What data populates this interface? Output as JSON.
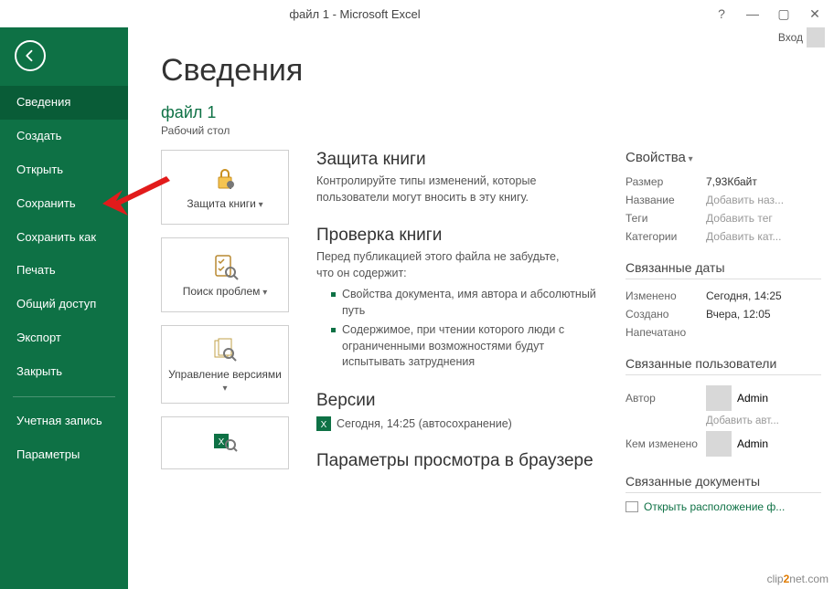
{
  "window": {
    "title": "файл 1 - Microsoft Excel",
    "help": "?",
    "user_label": "Вход"
  },
  "sidebar": {
    "items": [
      {
        "label": "Сведения",
        "active": true
      },
      {
        "label": "Создать"
      },
      {
        "label": "Открыть"
      },
      {
        "label": "Сохранить"
      },
      {
        "label": "Сохранить как"
      },
      {
        "label": "Печать"
      },
      {
        "label": "Общий доступ"
      },
      {
        "label": "Экспорт"
      },
      {
        "label": "Закрыть"
      }
    ],
    "footer": [
      {
        "label": "Учетная запись"
      },
      {
        "label": "Параметры"
      }
    ]
  },
  "main": {
    "heading": "Сведения",
    "filename": "файл 1",
    "filepath": "Рабочий стол",
    "cards": {
      "protect": "Защита книги",
      "inspect": "Поиск проблем",
      "versions": "Управление версиями"
    },
    "sections": {
      "protect": {
        "title": "Защита книги",
        "desc": "Контролируйте типы изменений, которые пользователи могут вносить в эту книгу."
      },
      "inspect": {
        "title": "Проверка книги",
        "desc": "Перед публикацией этого файла не забудьте, что он содержит:",
        "bullets": [
          "Свойства документа, имя автора и абсолютный путь",
          "Содержимое, при чтении которого люди с ограниченными возможностями будут испытывать затруднения"
        ]
      },
      "versions": {
        "title": "Версии",
        "line": "Сегодня, 14:25 (автосохранение)"
      },
      "browser": {
        "title": "Параметры просмотра в браузере"
      }
    }
  },
  "props": {
    "heading": "Свойства",
    "rows": {
      "size_l": "Размер",
      "size_v": "7,93Кбайт",
      "name_l": "Название",
      "name_v": "Добавить наз...",
      "tags_l": "Теги",
      "tags_v": "Добавить тег",
      "cat_l": "Категории",
      "cat_v": "Добавить кат..."
    },
    "dates_h": "Связанные даты",
    "dates": {
      "mod_l": "Изменено",
      "mod_v": "Сегодня, 14:25",
      "cre_l": "Создано",
      "cre_v": "Вчера, 12:05",
      "prn_l": "Напечатано",
      "prn_v": ""
    },
    "users_h": "Связанные пользователи",
    "author_l": "Автор",
    "author_v": "Admin",
    "add_author": "Добавить авт...",
    "modby_l": "Кем изменено",
    "modby_v": "Admin",
    "docs_h": "Связанные документы",
    "open_loc": "Открыть расположение ф..."
  },
  "watermark": {
    "a": "clip",
    "b": "2",
    "c": "net",
    "d": ".com"
  }
}
